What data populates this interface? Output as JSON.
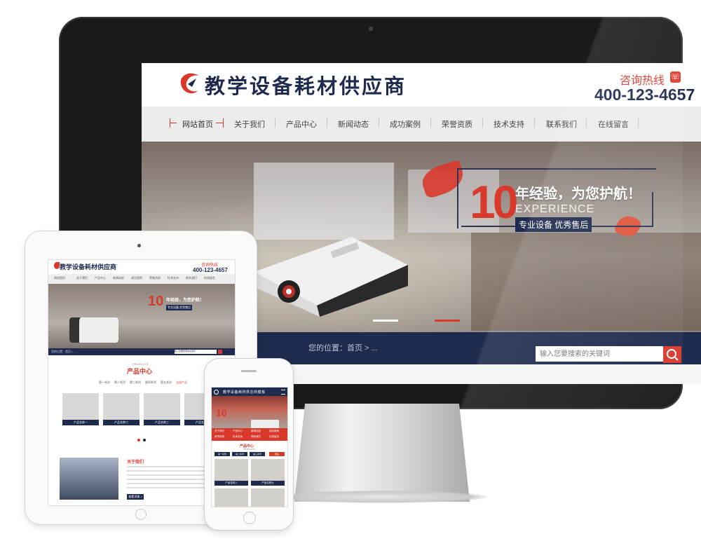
{
  "site": {
    "logo_text": "教学设备耗材供应商",
    "hotline_label": "咨询热线",
    "hotline_number": "400-123-4657"
  },
  "nav": {
    "items": [
      "网站首页",
      "关于我们",
      "产品中心",
      "新闻动态",
      "成功案例",
      "荣誉资质",
      "技术支持",
      "联系我们",
      "在线留言"
    ]
  },
  "banner": {
    "number": "10",
    "headline": "年经验，为您护航！",
    "subline": "EXPERIENCE",
    "tag": "专业设备 优秀售后"
  },
  "search": {
    "hint": "您的位置：首页 > ...",
    "placeholder": "输入您要搜索的关键词"
  },
  "tablet": {
    "logo_text": "教学设备耗材供应商",
    "hotline_label": "咨询热线",
    "hotline_number": "400-123-4657",
    "headline": "年经验，为您护航！",
    "tag": "专业设备 优秀售后",
    "products_en": "PRODUCTS",
    "products_title": "产品中心",
    "tabs": [
      "第一系列",
      "第二系列",
      "第三系列",
      "第四系列",
      "第五系列",
      "全部产品"
    ],
    "cards": [
      "产品名称一",
      "产品名称二",
      "产品名称三",
      "产品名称四"
    ],
    "about_title": "关于我们",
    "more": "查看详情 >"
  },
  "phone": {
    "title": "教学设备耗材供应商模板",
    "grid": [
      "关于我们",
      "产品中心",
      "新闻动态",
      "成功案例",
      "荣誉资质",
      "技术支持",
      "联系我们",
      "在线留言"
    ],
    "products_title": "产品中心",
    "products_en": "PRODUCTS",
    "tabs": [
      "第一系列",
      "第二系列",
      "第三系列",
      "更多"
    ],
    "cards": [
      "产品名称八",
      "产品名称九"
    ]
  },
  "colors": {
    "brand_navy": "#1e2a4e",
    "accent_red": "#d8392b",
    "nav_bg": "#ececec"
  }
}
